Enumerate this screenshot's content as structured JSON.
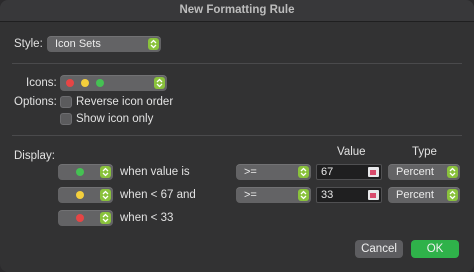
{
  "window": {
    "title": "New Formatting Rule"
  },
  "style": {
    "label": "Style:",
    "value": "Icon Sets"
  },
  "icons": {
    "label": "Icons:",
    "set": [
      "red-circle-icon",
      "yellow-circle-icon",
      "green-circle-icon"
    ]
  },
  "options": {
    "label": "Options:",
    "reverse_label": "Reverse icon order",
    "reverse_checked": false,
    "show_icon_only_label": "Show icon only",
    "show_icon_only_checked": false
  },
  "display": {
    "label": "Display:",
    "value_header": "Value",
    "type_header": "Type",
    "rows": [
      {
        "icon": "green-circle-icon",
        "condition": "when value is",
        "operator": ">=",
        "value": "67",
        "type": "Percent"
      },
      {
        "icon": "yellow-circle-icon",
        "condition": "when < 67 and",
        "operator": ">=",
        "value": "33",
        "type": "Percent"
      },
      {
        "icon": "red-circle-icon",
        "condition": "when < 33"
      }
    ]
  },
  "buttons": {
    "cancel": "Cancel",
    "ok": "OK"
  },
  "colors": {
    "accent": "#8ac23c",
    "ok": "#2fb24a",
    "red": "#e64545",
    "yellow": "#f4cf3c",
    "green": "#45c153"
  }
}
